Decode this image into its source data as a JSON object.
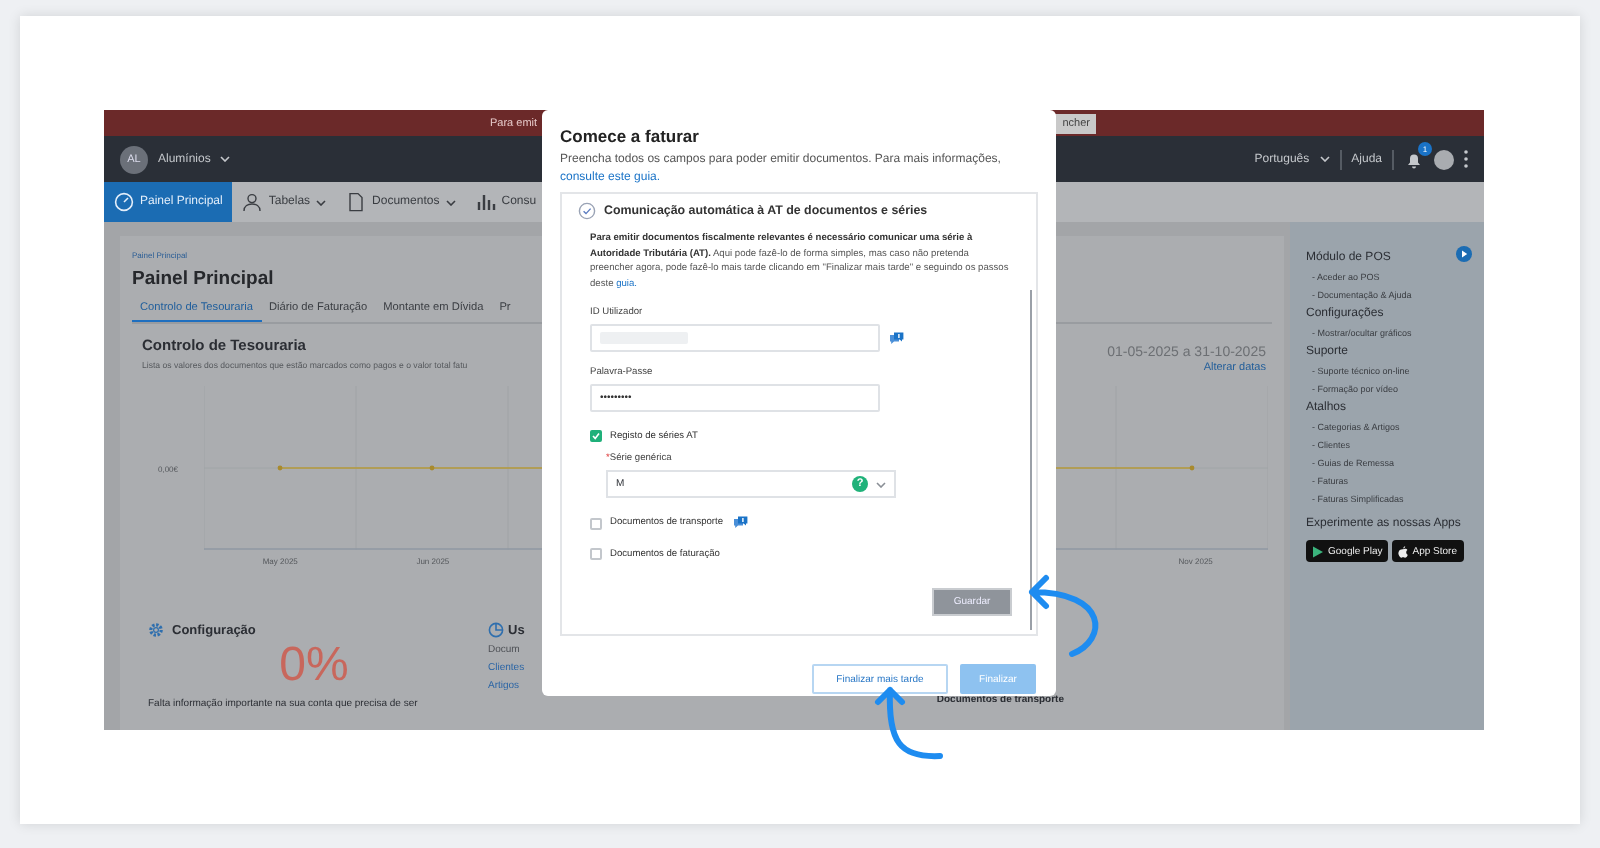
{
  "banner": {
    "text": "Para emit",
    "button": "ncher"
  },
  "header": {
    "avatar": "AL",
    "company": "Alumínios",
    "language": "Português",
    "help": "Ajuda",
    "notifications": "1"
  },
  "nav": [
    {
      "label": "Painel Principal",
      "selected": true,
      "dropdown": false
    },
    {
      "label": "Tabelas",
      "selected": false,
      "dropdown": true
    },
    {
      "label": "Documentos",
      "selected": false,
      "dropdown": true
    },
    {
      "label": "Consu",
      "selected": false,
      "dropdown": false
    }
  ],
  "breadcrumb": "Painel Principal",
  "page_title": "Painel Principal",
  "tabs": [
    {
      "label": "Controlo de Tesouraria",
      "selected": true
    },
    {
      "label": "Diário de Faturação",
      "selected": false
    },
    {
      "label": "Montante em Dívida",
      "selected": false
    },
    {
      "label": "Pr",
      "selected": false
    }
  ],
  "treasury": {
    "title": "Controlo de Tesouraria",
    "subtitle": "Lista os valores dos documentos que estão marcados como pagos e o valor total fatu",
    "date_range": "01-05-2025 a 31-10-2025",
    "change_dates": "Alterar datas",
    "y_label": "0,00€",
    "x_labels": [
      "May 2025",
      "Jun 2025",
      "Nov 2025"
    ]
  },
  "config": {
    "title": "Configuração",
    "percent": "0%",
    "text": "Falta informação importante na sua conta que precisa de ser"
  },
  "usage": {
    "title": "Us",
    "items": [
      {
        "label": "Docum",
        "link": false
      },
      {
        "label": "Clientes",
        "link": true
      },
      {
        "label": "Artigos",
        "link": true
      }
    ],
    "side_title": "Documentos de transporte"
  },
  "sidebar": [
    {
      "title": "Módulo de POS",
      "items": [
        "- Aceder ao POS",
        "- Documentação & Ajuda"
      ]
    },
    {
      "title": "Configurações",
      "items": [
        "- Mostrar/ocultar gráficos"
      ]
    },
    {
      "title": "Suporte",
      "items": [
        "- Suporte técnico on-line",
        "- Formação por vídeo"
      ]
    },
    {
      "title": "Atalhos",
      "items": [
        "- Categorias & Artigos",
        "- Clientes",
        "- Guias de Remessa",
        "- Faturas",
        "- Faturas Simplificadas"
      ]
    }
  ],
  "apps": {
    "title": "Experimente as nossas Apps",
    "stores": [
      "Google Play",
      "App Store"
    ]
  },
  "modal": {
    "title": "Comece a faturar",
    "description": "Preencha todos os campos para poder emitir documentos. Para mais informações, ",
    "description_link": "consulte este guia.",
    "section": {
      "title": "Comunicação automática à AT de documentos e séries",
      "text": "**Para emitir documentos fiscalmente relevantes é necessário comunicar uma série à Autoridade Tributária (AT).** Aqui pode fazê-lo de forma simples, mas caso não pretenda preencher agora, pode fazê-lo mais tarde clicando em \"Finalizar mais tarde\" e seguindo os passos deste ",
      "text_link": "guia.",
      "fields": [
        {
          "kind": "text",
          "label": "ID Utilizador",
          "blurred": true,
          "info": true
        },
        {
          "kind": "password",
          "label": "Palavra-Passe",
          "value": "•••••••••"
        },
        {
          "kind": "checkbox",
          "label": "Registo de séries AT",
          "checked": true,
          "children": [
            {
              "kind": "select",
              "label": "Série genérica",
              "required_mark": "*",
              "value": "M",
              "help": "?"
            }
          ]
        },
        {
          "kind": "checkbox",
          "label": "Documentos de transporte",
          "checked": false,
          "info": true
        },
        {
          "kind": "checkbox",
          "label": "Documentos de faturação",
          "checked": false
        }
      ],
      "save": "Guardar"
    },
    "buttons": [
      {
        "label": "Finalizar mais tarde",
        "kind": "secondary",
        "disabled": false
      },
      {
        "label": "Finalizar",
        "kind": "primary",
        "disabled": true
      }
    ]
  }
}
